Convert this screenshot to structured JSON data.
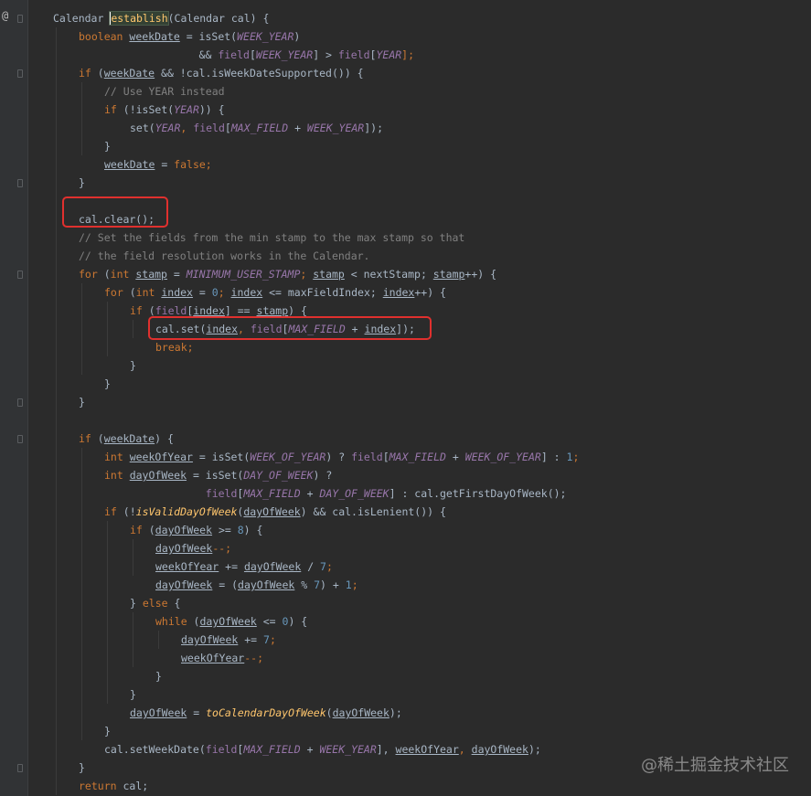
{
  "editor": {
    "gutter_marker": "@",
    "theme": {
      "background": "#2b2b2b",
      "keyword": "#cc7832",
      "field": "#9876aa",
      "number": "#6897bb",
      "comment": "#808080",
      "method": "#ffc66d",
      "default": "#a9b7c6",
      "highlight_box": "#e0302e"
    },
    "lines": [
      {
        "indent": 1,
        "tokens": [
          {
            "t": "Calendar ",
            "c": ""
          },
          {
            "t": "establish",
            "c": "fn hl caret"
          },
          {
            "t": "(Calendar cal) {",
            "c": ""
          }
        ]
      },
      {
        "indent": 2,
        "tokens": [
          {
            "t": "boolean ",
            "c": "kw"
          },
          {
            "t": "weekDate",
            "c": "lv"
          },
          {
            "t": " = isSet(",
            "c": ""
          },
          {
            "t": "WEEK_YEAR",
            "c": "st"
          },
          {
            "t": ")",
            "c": ""
          }
        ]
      },
      {
        "indent": 2,
        "tokens": [
          {
            "t": "                   && ",
            "c": ""
          },
          {
            "t": "field",
            "c": "fld"
          },
          {
            "t": "[",
            "c": ""
          },
          {
            "t": "WEEK_YEAR",
            "c": "st"
          },
          {
            "t": "] > ",
            "c": ""
          },
          {
            "t": "field",
            "c": "fld"
          },
          {
            "t": "[",
            "c": ""
          },
          {
            "t": "YEAR",
            "c": "st"
          },
          {
            "t": "];",
            "c": "kw"
          }
        ]
      },
      {
        "indent": 2,
        "tokens": [
          {
            "t": "if ",
            "c": "kw"
          },
          {
            "t": "(",
            "c": ""
          },
          {
            "t": "weekDate",
            "c": "lv"
          },
          {
            "t": " && !cal.isWeekDateSupported()) {",
            "c": ""
          }
        ]
      },
      {
        "indent": 3,
        "tokens": [
          {
            "t": "// Use YEAR instead",
            "c": "cm"
          }
        ]
      },
      {
        "indent": 3,
        "tokens": [
          {
            "t": "if ",
            "c": "kw"
          },
          {
            "t": "(!isSet(",
            "c": ""
          },
          {
            "t": "YEAR",
            "c": "st"
          },
          {
            "t": ")) {",
            "c": ""
          }
        ]
      },
      {
        "indent": 4,
        "tokens": [
          {
            "t": "set(",
            "c": ""
          },
          {
            "t": "YEAR",
            "c": "st"
          },
          {
            "t": ", ",
            "c": "kw"
          },
          {
            "t": "field",
            "c": "fld"
          },
          {
            "t": "[",
            "c": ""
          },
          {
            "t": "MAX_FIELD",
            "c": "st"
          },
          {
            "t": " + ",
            "c": ""
          },
          {
            "t": "WEEK_YEAR",
            "c": "st"
          },
          {
            "t": "]);",
            "c": ""
          }
        ]
      },
      {
        "indent": 3,
        "tokens": [
          {
            "t": "}",
            "c": ""
          }
        ]
      },
      {
        "indent": 3,
        "tokens": [
          {
            "t": "weekDate",
            "c": "lv"
          },
          {
            "t": " = ",
            "c": ""
          },
          {
            "t": "false",
            "c": "kw"
          },
          {
            "t": ";",
            "c": "kw"
          }
        ]
      },
      {
        "indent": 2,
        "tokens": [
          {
            "t": "}",
            "c": ""
          }
        ]
      },
      {
        "indent": 0,
        "tokens": []
      },
      {
        "indent": 2,
        "tokens": [
          {
            "t": "cal.clear();",
            "c": ""
          }
        ]
      },
      {
        "indent": 2,
        "tokens": [
          {
            "t": "// Set the fields from the min stamp to the max stamp so that",
            "c": "cm"
          }
        ]
      },
      {
        "indent": 2,
        "tokens": [
          {
            "t": "// the field resolution works in the Calendar.",
            "c": "cm"
          }
        ]
      },
      {
        "indent": 2,
        "tokens": [
          {
            "t": "for ",
            "c": "kw"
          },
          {
            "t": "(",
            "c": ""
          },
          {
            "t": "int ",
            "c": "kw"
          },
          {
            "t": "stamp",
            "c": "lv"
          },
          {
            "t": " = ",
            "c": ""
          },
          {
            "t": "MINIMUM_USER_STAMP",
            "c": "st"
          },
          {
            "t": "; ",
            "c": "kw"
          },
          {
            "t": "stamp",
            "c": "lv"
          },
          {
            "t": " < nextStamp; ",
            "c": ""
          },
          {
            "t": "stamp",
            "c": "lv"
          },
          {
            "t": "++) {",
            "c": ""
          }
        ]
      },
      {
        "indent": 3,
        "tokens": [
          {
            "t": "for ",
            "c": "kw"
          },
          {
            "t": "(",
            "c": ""
          },
          {
            "t": "int ",
            "c": "kw"
          },
          {
            "t": "index",
            "c": "lv"
          },
          {
            "t": " = ",
            "c": ""
          },
          {
            "t": "0",
            "c": "num"
          },
          {
            "t": "; ",
            "c": "kw"
          },
          {
            "t": "index",
            "c": "lv"
          },
          {
            "t": " <= maxFieldIndex; ",
            "c": ""
          },
          {
            "t": "index",
            "c": "lv"
          },
          {
            "t": "++) {",
            "c": ""
          }
        ]
      },
      {
        "indent": 4,
        "tokens": [
          {
            "t": "if ",
            "c": "kw"
          },
          {
            "t": "(",
            "c": ""
          },
          {
            "t": "field",
            "c": "fld"
          },
          {
            "t": "[",
            "c": ""
          },
          {
            "t": "index",
            "c": "lv"
          },
          {
            "t": "] == ",
            "c": ""
          },
          {
            "t": "stamp",
            "c": "lv"
          },
          {
            "t": ") {",
            "c": ""
          }
        ]
      },
      {
        "indent": 5,
        "tokens": [
          {
            "t": "cal.set(",
            "c": ""
          },
          {
            "t": "index",
            "c": "lv"
          },
          {
            "t": ", ",
            "c": "kw"
          },
          {
            "t": "field",
            "c": "fld"
          },
          {
            "t": "[",
            "c": ""
          },
          {
            "t": "MAX_FIELD",
            "c": "st"
          },
          {
            "t": " + ",
            "c": ""
          },
          {
            "t": "index",
            "c": "lv"
          },
          {
            "t": "]);",
            "c": ""
          }
        ]
      },
      {
        "indent": 5,
        "tokens": [
          {
            "t": "break;",
            "c": "kw"
          }
        ]
      },
      {
        "indent": 4,
        "tokens": [
          {
            "t": "}",
            "c": ""
          }
        ]
      },
      {
        "indent": 3,
        "tokens": [
          {
            "t": "}",
            "c": ""
          }
        ]
      },
      {
        "indent": 2,
        "tokens": [
          {
            "t": "}",
            "c": ""
          }
        ]
      },
      {
        "indent": 0,
        "tokens": []
      },
      {
        "indent": 2,
        "tokens": [
          {
            "t": "if ",
            "c": "kw"
          },
          {
            "t": "(",
            "c": ""
          },
          {
            "t": "weekDate",
            "c": "lv"
          },
          {
            "t": ") {",
            "c": ""
          }
        ]
      },
      {
        "indent": 3,
        "tokens": [
          {
            "t": "int ",
            "c": "kw"
          },
          {
            "t": "weekOfYear",
            "c": "lv"
          },
          {
            "t": " = isSet(",
            "c": ""
          },
          {
            "t": "WEEK_OF_YEAR",
            "c": "st"
          },
          {
            "t": ") ? ",
            "c": ""
          },
          {
            "t": "field",
            "c": "fld"
          },
          {
            "t": "[",
            "c": ""
          },
          {
            "t": "MAX_FIELD",
            "c": "st"
          },
          {
            "t": " + ",
            "c": ""
          },
          {
            "t": "WEEK_OF_YEAR",
            "c": "st"
          },
          {
            "t": "] : ",
            "c": ""
          },
          {
            "t": "1",
            "c": "num"
          },
          {
            "t": ";",
            "c": "kw"
          }
        ]
      },
      {
        "indent": 3,
        "tokens": [
          {
            "t": "int ",
            "c": "kw"
          },
          {
            "t": "dayOfWeek",
            "c": "lv"
          },
          {
            "t": " = isSet(",
            "c": ""
          },
          {
            "t": "DAY_OF_WEEK",
            "c": "st"
          },
          {
            "t": ") ?",
            "c": ""
          }
        ]
      },
      {
        "indent": 3,
        "tokens": [
          {
            "t": "                ",
            "c": ""
          },
          {
            "t": "field",
            "c": "fld"
          },
          {
            "t": "[",
            "c": ""
          },
          {
            "t": "MAX_FIELD",
            "c": "st"
          },
          {
            "t": " + ",
            "c": ""
          },
          {
            "t": "DAY_OF_WEEK",
            "c": "st"
          },
          {
            "t": "] : cal.getFirstDayOfWeek();",
            "c": ""
          }
        ]
      },
      {
        "indent": 3,
        "tokens": [
          {
            "t": "if ",
            "c": "kw"
          },
          {
            "t": "(!",
            "c": ""
          },
          {
            "t": "isValidDayOfWeek",
            "c": "fni"
          },
          {
            "t": "(",
            "c": ""
          },
          {
            "t": "dayOfWeek",
            "c": "lv"
          },
          {
            "t": ") && cal.isLenient()) {",
            "c": ""
          }
        ]
      },
      {
        "indent": 4,
        "tokens": [
          {
            "t": "if ",
            "c": "kw"
          },
          {
            "t": "(",
            "c": ""
          },
          {
            "t": "dayOfWeek",
            "c": "lv"
          },
          {
            "t": " >= ",
            "c": ""
          },
          {
            "t": "8",
            "c": "num"
          },
          {
            "t": ") {",
            "c": ""
          }
        ]
      },
      {
        "indent": 5,
        "tokens": [
          {
            "t": "dayOfWeek",
            "c": "lv"
          },
          {
            "t": "--;",
            "c": "kw"
          }
        ]
      },
      {
        "indent": 5,
        "tokens": [
          {
            "t": "weekOfYear",
            "c": "lv"
          },
          {
            "t": " += ",
            "c": ""
          },
          {
            "t": "dayOfWeek",
            "c": "lv"
          },
          {
            "t": " / ",
            "c": ""
          },
          {
            "t": "7",
            "c": "num"
          },
          {
            "t": ";",
            "c": "kw"
          }
        ]
      },
      {
        "indent": 5,
        "tokens": [
          {
            "t": "dayOfWeek",
            "c": "lv"
          },
          {
            "t": " = (",
            "c": ""
          },
          {
            "t": "dayOfWeek",
            "c": "lv"
          },
          {
            "t": " % ",
            "c": ""
          },
          {
            "t": "7",
            "c": "num"
          },
          {
            "t": ") + ",
            "c": ""
          },
          {
            "t": "1",
            "c": "num"
          },
          {
            "t": ";",
            "c": "kw"
          }
        ]
      },
      {
        "indent": 4,
        "tokens": [
          {
            "t": "} ",
            "c": ""
          },
          {
            "t": "else ",
            "c": "kw"
          },
          {
            "t": "{",
            "c": ""
          }
        ]
      },
      {
        "indent": 5,
        "tokens": [
          {
            "t": "while ",
            "c": "kw"
          },
          {
            "t": "(",
            "c": ""
          },
          {
            "t": "dayOfWeek",
            "c": "lv"
          },
          {
            "t": " <= ",
            "c": ""
          },
          {
            "t": "0",
            "c": "num"
          },
          {
            "t": ") {",
            "c": ""
          }
        ]
      },
      {
        "indent": 6,
        "tokens": [
          {
            "t": "dayOfWeek",
            "c": "lv"
          },
          {
            "t": " += ",
            "c": ""
          },
          {
            "t": "7",
            "c": "num"
          },
          {
            "t": ";",
            "c": "kw"
          }
        ]
      },
      {
        "indent": 6,
        "tokens": [
          {
            "t": "weekOfYear",
            "c": "lv"
          },
          {
            "t": "--;",
            "c": "kw"
          }
        ]
      },
      {
        "indent": 5,
        "tokens": [
          {
            "t": "}",
            "c": ""
          }
        ]
      },
      {
        "indent": 4,
        "tokens": [
          {
            "t": "}",
            "c": ""
          }
        ]
      },
      {
        "indent": 4,
        "tokens": [
          {
            "t": "dayOfWeek",
            "c": "lv"
          },
          {
            "t": " = ",
            "c": ""
          },
          {
            "t": "toCalendarDayOfWeek",
            "c": "fni"
          },
          {
            "t": "(",
            "c": ""
          },
          {
            "t": "dayOfWeek",
            "c": "lv"
          },
          {
            "t": ");",
            "c": ""
          }
        ]
      },
      {
        "indent": 3,
        "tokens": [
          {
            "t": "}",
            "c": ""
          }
        ]
      },
      {
        "indent": 3,
        "tokens": [
          {
            "t": "cal.setWeekDate(",
            "c": ""
          },
          {
            "t": "field",
            "c": "fld"
          },
          {
            "t": "[",
            "c": ""
          },
          {
            "t": "MAX_FIELD",
            "c": "st"
          },
          {
            "t": " + ",
            "c": ""
          },
          {
            "t": "WEEK_YEAR",
            "c": "st"
          },
          {
            "t": "], ",
            "c": ""
          },
          {
            "t": "weekOfYear",
            "c": "lv"
          },
          {
            "t": ", ",
            "c": "kw"
          },
          {
            "t": "dayOfWeek",
            "c": "lv"
          },
          {
            "t": ");",
            "c": ""
          }
        ]
      },
      {
        "indent": 2,
        "tokens": [
          {
            "t": "}",
            "c": ""
          }
        ]
      },
      {
        "indent": 2,
        "tokens": [
          {
            "t": "return ",
            "c": "kw"
          },
          {
            "t": "cal;",
            "c": ""
          }
        ]
      }
    ]
  },
  "watermark": "@稀土掘金技术社区"
}
